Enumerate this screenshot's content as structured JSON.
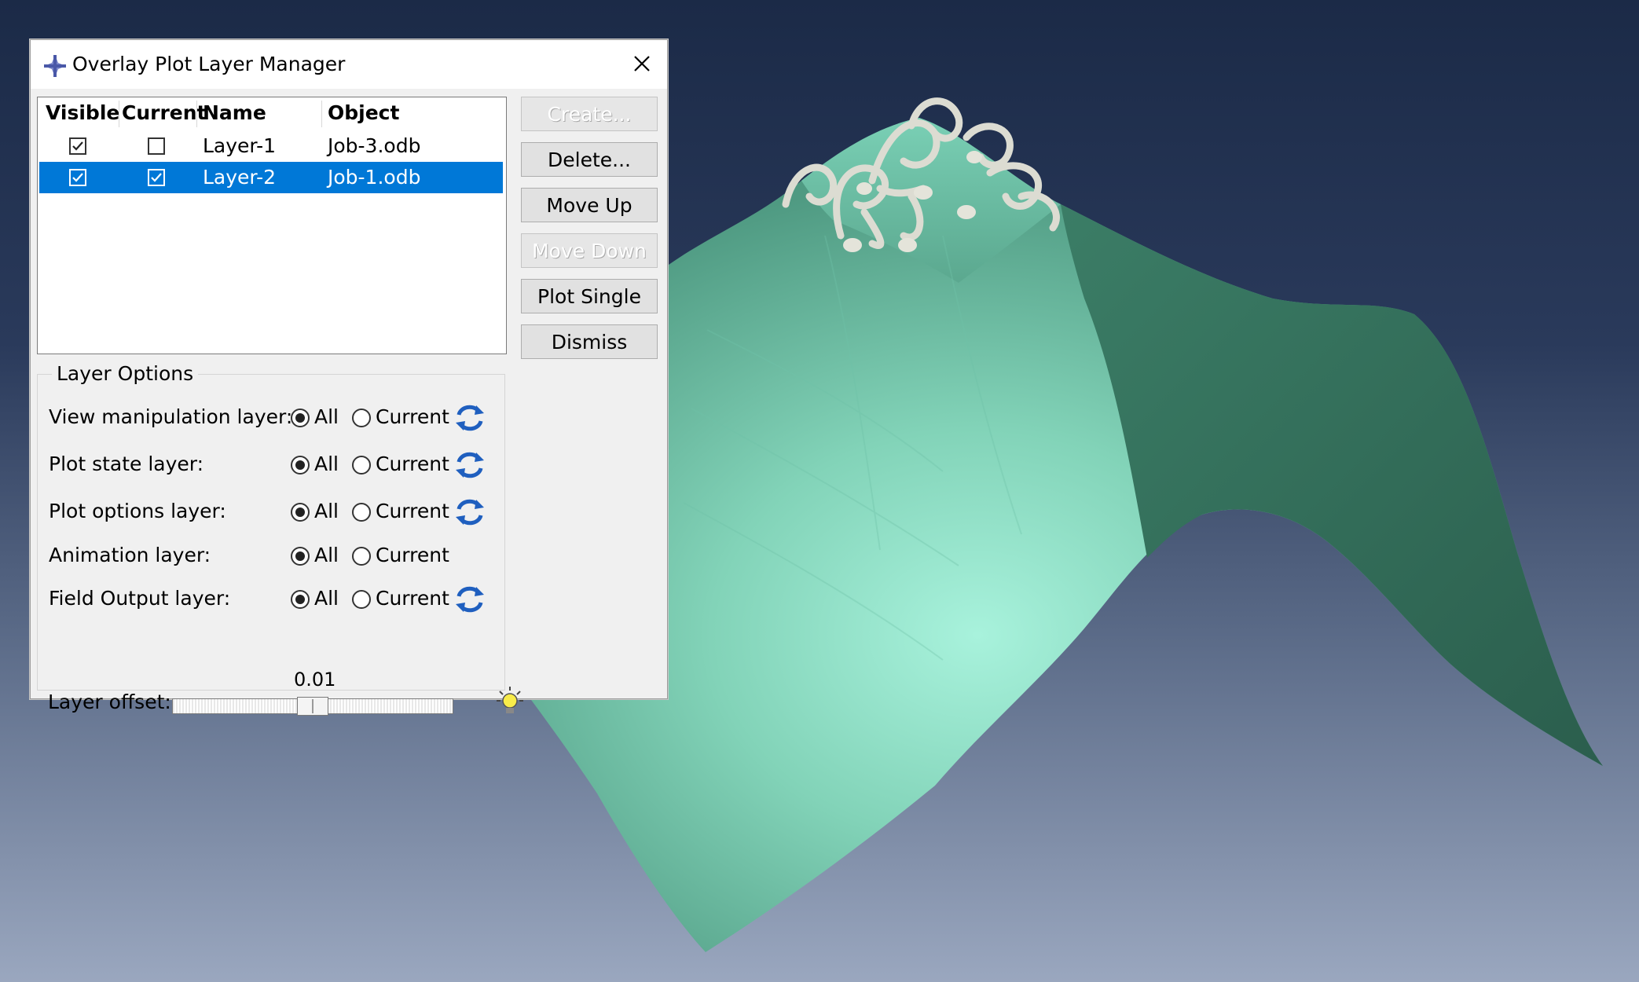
{
  "dialog": {
    "title": "Overlay Plot Layer Manager",
    "close_label": "✕"
  },
  "layer_table": {
    "columns": [
      "Visible",
      "Current",
      "Name",
      "Object"
    ],
    "rows": [
      {
        "visible": true,
        "current": false,
        "name": "Layer-1",
        "object": "Job-3.odb",
        "selected": false
      },
      {
        "visible": true,
        "current": true,
        "name": "Layer-2",
        "object": "Job-1.odb",
        "selected": true
      }
    ]
  },
  "buttons": {
    "create": "Create...",
    "delete": "Delete...",
    "move_up": "Move Up",
    "move_down": "Move Down",
    "plot_single": "Plot Single",
    "dismiss": "Dismiss"
  },
  "layer_options": {
    "title": "Layer Options",
    "all_label": "All",
    "current_label": "Current",
    "rows": [
      {
        "label": "View manipulation layer:",
        "selected": "All",
        "sync_icon": true
      },
      {
        "label": "Plot state layer:",
        "selected": "All",
        "sync_icon": true
      },
      {
        "label": "Plot options layer:",
        "selected": "All",
        "sync_icon": true
      },
      {
        "label": "Animation layer:",
        "selected": "All",
        "sync_icon": false
      },
      {
        "label": "Field Output layer:",
        "selected": "All",
        "sync_icon": true
      }
    ],
    "offset_label": "Layer offset:",
    "offset_value": "0.01",
    "offset_fraction": 0.5
  },
  "icons": {
    "title": "abaqus-logo-icon",
    "sync": "sync-arrows-icon",
    "bulb": "light-bulb-icon"
  },
  "colors": {
    "selection": "#0078d7",
    "surface_light": "#9eecd4",
    "surface_dark": "#2f6a55",
    "sync_icon": "#1f5fbf"
  }
}
